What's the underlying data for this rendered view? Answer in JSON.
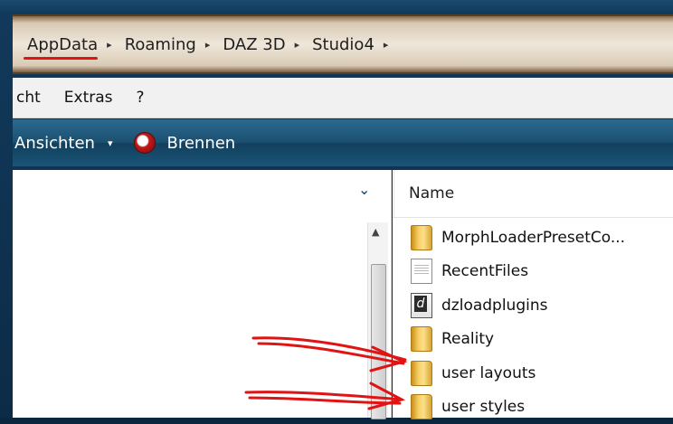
{
  "address": {
    "breadcrumbs": [
      "AppData",
      "Roaming",
      "DAZ 3D",
      "Studio4"
    ],
    "separator": "▸",
    "trailing_separator": "▸"
  },
  "menu": {
    "items": [
      "cht",
      "Extras",
      "?"
    ]
  },
  "toolbar": {
    "views_label": "Ansichten",
    "views_arrow": "▾",
    "burn_label": "Brennen"
  },
  "left_pane": {
    "chevron": "⌄",
    "scroll_up": "▲"
  },
  "right_pane": {
    "column_header": "Name",
    "files": [
      {
        "name": "MorphLoaderPresetCo...",
        "icon": "folder-icon"
      },
      {
        "name": "RecentFiles",
        "icon": "text-file-icon"
      },
      {
        "name": "dzloadplugins",
        "icon": "daz-file-icon"
      },
      {
        "name": "Reality",
        "icon": "folder-icon"
      },
      {
        "name": "user layouts",
        "icon": "folder-icon"
      },
      {
        "name": "user styles",
        "icon": "folder-icon"
      }
    ]
  },
  "colors": {
    "annotation_red": "#e01414",
    "toolbar_blue": "#1b4f6f",
    "address_bar": "#efe7da"
  }
}
